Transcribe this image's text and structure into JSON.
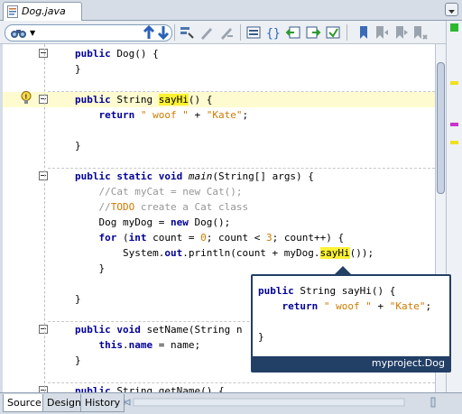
{
  "tab": {
    "title": "Dog.java"
  },
  "toolbar": {
    "icons": [
      "binoculars-icon",
      "prev-occurrence-icon",
      "next-occurrence-icon",
      "toggle-highlight-icon",
      "find-selection-icon",
      "find-selection-alt-icon",
      "toggle-rect-selection-icon",
      "toggle-match-icon",
      "shift-left-icon",
      "shift-right-icon",
      "start-macro-icon",
      "toggle-bookmark-icon",
      "prev-bookmark-icon",
      "next-bookmark-icon",
      "toggle-comment-icon"
    ]
  },
  "editor": {
    "lines": [
      {
        "id": "l1",
        "parts": [
          [
            "kw",
            "public"
          ],
          [
            "t",
            " Dog() {"
          ]
        ]
      },
      {
        "id": "l2",
        "parts": [
          [
            "t",
            "}"
          ]
        ]
      },
      {
        "id": "l3",
        "parts": []
      },
      {
        "id": "l4",
        "parts": [
          [
            "kw",
            "public"
          ],
          [
            "t",
            " String "
          ],
          [
            "mhl",
            "sayHi"
          ],
          [
            "t",
            "() {"
          ]
        ]
      },
      {
        "id": "l5",
        "parts": [
          [
            "t",
            "    "
          ],
          [
            "kw",
            "return"
          ],
          [
            "str",
            " \" woof \""
          ],
          [
            "t",
            " + "
          ],
          [
            "str",
            "\"Kate\""
          ],
          [
            "t",
            ";"
          ]
        ]
      },
      {
        "id": "l6",
        "parts": []
      },
      {
        "id": "l7",
        "parts": [
          [
            "t",
            "}"
          ]
        ]
      },
      {
        "id": "l8",
        "parts": []
      },
      {
        "id": "l9",
        "parts": [
          [
            "kw",
            "public static void "
          ],
          [
            "ital",
            "main"
          ],
          [
            "t",
            "(String[] args) {"
          ]
        ]
      },
      {
        "id": "l10",
        "parts": [
          [
            "t",
            "    "
          ],
          [
            "cm",
            "//Cat myCat = new Cat();"
          ]
        ]
      },
      {
        "id": "l11",
        "parts": [
          [
            "t",
            "    "
          ],
          [
            "cm",
            "//"
          ],
          [
            "todo",
            "TODO"
          ],
          [
            "cm",
            " create a Cat class"
          ]
        ]
      },
      {
        "id": "l12",
        "parts": [
          [
            "t",
            "    Dog myDog = "
          ],
          [
            "kw",
            "new"
          ],
          [
            "t",
            " Dog();"
          ]
        ]
      },
      {
        "id": "l13",
        "parts": [
          [
            "t",
            "    "
          ],
          [
            "kw",
            "for"
          ],
          [
            "t",
            " ("
          ],
          [
            "kw",
            "int"
          ],
          [
            "t",
            " count = "
          ],
          [
            "str",
            "0"
          ],
          [
            "t",
            "; count < "
          ],
          [
            "str",
            "3"
          ],
          [
            "t",
            "; count++) {"
          ]
        ]
      },
      {
        "id": "l14",
        "parts": [
          [
            "t",
            "        System."
          ],
          [
            "kw",
            "out"
          ],
          [
            "t",
            ".println(count + myDog."
          ],
          [
            "mhl",
            "sayHi"
          ],
          [
            "t",
            "());"
          ]
        ]
      },
      {
        "id": "l15",
        "parts": [
          [
            "t",
            "    }"
          ]
        ]
      },
      {
        "id": "l16",
        "parts": []
      },
      {
        "id": "l17",
        "parts": [
          [
            "t",
            "}"
          ]
        ]
      },
      {
        "id": "l18",
        "parts": []
      },
      {
        "id": "l19",
        "parts": [
          [
            "kw",
            "public void"
          ],
          [
            "t",
            " setName(String n"
          ]
        ]
      },
      {
        "id": "l20",
        "parts": [
          [
            "t",
            "    "
          ],
          [
            "kw",
            "this"
          ],
          [
            "t",
            "."
          ],
          [
            "kw",
            "name"
          ],
          [
            "t",
            " = name;"
          ]
        ]
      },
      {
        "id": "l21",
        "parts": [
          [
            "t",
            "}"
          ]
        ]
      },
      {
        "id": "l22",
        "parts": []
      },
      {
        "id": "l23",
        "parts": [
          [
            "kw",
            "public"
          ],
          [
            "t",
            " String getName() {"
          ]
        ]
      }
    ]
  },
  "tooltip": {
    "lines": [
      [
        [
          "kw",
          "public"
        ],
        [
          "t",
          " String sayHi() {"
        ]
      ],
      [
        [
          "t",
          "    "
        ],
        [
          "kw",
          "return"
        ],
        [
          "str",
          " \" woof \""
        ],
        [
          "t",
          " + "
        ],
        [
          "str",
          "\"Kate\""
        ],
        [
          "t",
          ";"
        ]
      ],
      [],
      [
        [
          "t",
          "}"
        ]
      ]
    ],
    "footer": "myproject.Dog"
  },
  "bottom_tabs": [
    "Source",
    "Design",
    "History"
  ],
  "colors": {
    "accent": "#223f66",
    "highlight": "#fcf232",
    "current_line": "#fefbd0",
    "keyword": "#000099",
    "string": "#ce7b00",
    "comment": "#969696"
  }
}
